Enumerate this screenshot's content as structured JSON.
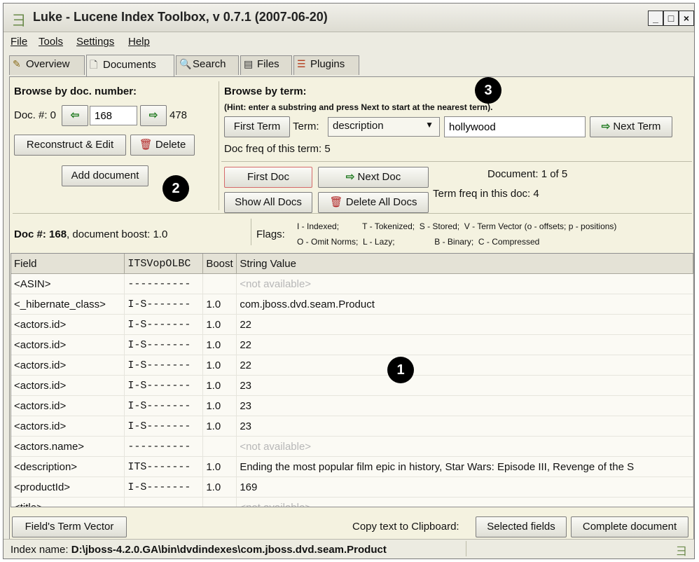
{
  "window": {
    "title": "Luke - Lucene Index Toolbox, v 0.7.1 (2007-06-20)",
    "controls": [
      "_",
      "□",
      "×"
    ]
  },
  "menu": [
    "File",
    "Tools",
    "Settings",
    "Help"
  ],
  "tabs": [
    {
      "label": "Overview",
      "icon": "overview-icon"
    },
    {
      "label": "Documents",
      "icon": "documents-icon"
    },
    {
      "label": "Search",
      "icon": "search-icon"
    },
    {
      "label": "Files",
      "icon": "files-icon"
    },
    {
      "label": "Plugins",
      "icon": "plugins-icon"
    }
  ],
  "browse_doc": {
    "header": "Browse by doc. number:",
    "doc_label": "Doc. #: 0",
    "doc_value": "168",
    "max_doc": "478",
    "reconstruct_button": "Reconstruct & Edit",
    "delete_button": "Delete",
    "add_button": "Add document"
  },
  "browse_term": {
    "header": "Browse by term:",
    "hint": "(Hint: enter a substring and press Next to start at the nearest term).",
    "first_term_button": "First Term",
    "term_label": "Term:",
    "term_field": "description",
    "term_text": "hollywood",
    "next_term_button": "Next Term",
    "doc_freq": "Doc freq of this term: 5",
    "first_doc_button": "First Doc",
    "next_doc_button": "Next Doc",
    "show_all_button": "Show All Docs",
    "delete_all_button": "Delete All Docs",
    "document_position": "Document: 1  of 5",
    "term_freq": "Term freq in this doc: 4"
  },
  "badges": [
    "1",
    "2",
    "3"
  ],
  "doc_info": {
    "label": "Doc #: 168",
    "boost": ", document boost: 1.0",
    "flags_label": "Flags:",
    "flags_row1": "I - Indexed;          T - Tokenized;  S - Stored;  V - Term Vector (o - offsets; p - positions)",
    "flags_row2": "O - Omit Norms;  L - Lazy;                 B - Binary;  C - Compressed"
  },
  "table": {
    "headers": [
      "Field",
      "ITSVopOLBC",
      "Boost",
      "String Value"
    ],
    "rows": [
      {
        "field": "<ASIN>",
        "flags": "----------",
        "boost": "",
        "value": "<not available>",
        "na": true
      },
      {
        "field": "<_hibernate_class>",
        "flags": "I-S-------",
        "boost": "1.0",
        "value": "com.jboss.dvd.seam.Product",
        "na": false
      },
      {
        "field": "<actors.id>",
        "flags": "I-S-------",
        "boost": "1.0",
        "value": "22",
        "na": false
      },
      {
        "field": "<actors.id>",
        "flags": "I-S-------",
        "boost": "1.0",
        "value": "22",
        "na": false
      },
      {
        "field": "<actors.id>",
        "flags": "I-S-------",
        "boost": "1.0",
        "value": "22",
        "na": false
      },
      {
        "field": "<actors.id>",
        "flags": "I-S-------",
        "boost": "1.0",
        "value": "23",
        "na": false
      },
      {
        "field": "<actors.id>",
        "flags": "I-S-------",
        "boost": "1.0",
        "value": "23",
        "na": false
      },
      {
        "field": "<actors.id>",
        "flags": "I-S-------",
        "boost": "1.0",
        "value": "23",
        "na": false
      },
      {
        "field": "<actors.name>",
        "flags": "----------",
        "boost": "",
        "value": "<not available>",
        "na": true
      },
      {
        "field": "<description>",
        "flags": "ITS-------",
        "boost": "1.0",
        "value": "Ending the most popular film epic in history, Star Wars: Episode III, Revenge of the S",
        "na": false
      },
      {
        "field": "<productId>",
        "flags": "I-S-------",
        "boost": "1.0",
        "value": "169",
        "na": false
      },
      {
        "field": "<title>",
        "flags": "----------",
        "boost": "",
        "value": "<not available>",
        "na": true
      }
    ]
  },
  "bottom": {
    "term_vector_button": "Field's Term Vector",
    "copy_label": "Copy text to Clipboard:",
    "selected_button": "Selected fields",
    "complete_button": "Complete document"
  },
  "status": {
    "label": "Index name:",
    "path": "D:\\jboss-4.2.0.GA\\bin\\dvdindexes\\com.jboss.dvd.seam.Product"
  }
}
